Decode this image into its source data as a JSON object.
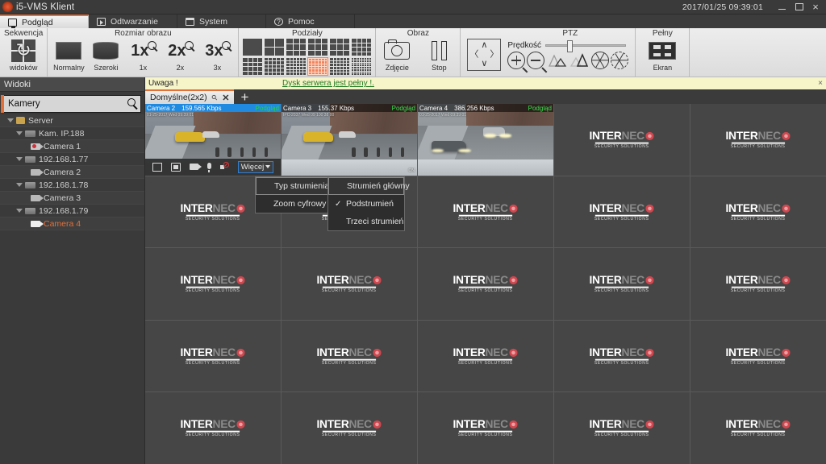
{
  "window": {
    "title": "i5-VMS Klient",
    "clock": "2017/01/25 09:39:01",
    "minimize": "–",
    "maximize": "□",
    "close": "×"
  },
  "menu_tabs": [
    {
      "label": "Podgląd",
      "icon": "monitor-icon",
      "active": true
    },
    {
      "label": "Odtwarzanie",
      "icon": "play-icon",
      "active": false
    },
    {
      "label": "System",
      "icon": "folder-icon",
      "active": false
    },
    {
      "label": "Pomoc",
      "icon": "help-icon",
      "active": false
    }
  ],
  "ribbon": {
    "groups": [
      {
        "title": "Sekwencja",
        "items": [
          {
            "label": "widoków",
            "icon": "sequence-views-icon"
          }
        ]
      },
      {
        "title": "Rozmiar obrazu",
        "items": [
          {
            "label": "Normalny",
            "icon": "screen-normal-icon"
          },
          {
            "label": "Szeroki",
            "icon": "screen-wide-icon"
          },
          {
            "label": "1x",
            "icon": "zoom-1x-icon"
          },
          {
            "label": "2x",
            "icon": "zoom-2x-icon"
          },
          {
            "label": "3x",
            "icon": "zoom-3x-icon"
          }
        ]
      },
      {
        "title": "Podziały",
        "items": []
      },
      {
        "title": "Obraz",
        "items": [
          {
            "label": "Zdjęcie",
            "icon": "camera-snapshot-icon"
          },
          {
            "label": "Stop",
            "icon": "pause-icon"
          }
        ]
      },
      {
        "title": "PTZ",
        "speed_label": "Prędkość",
        "items": []
      },
      {
        "title": "Pełny",
        "items": [
          {
            "label": "Ekran",
            "icon": "fullscreen-icon"
          }
        ]
      }
    ],
    "selected_layout_index": 9,
    "accent": "#e2703a"
  },
  "sidebar": {
    "header": "Widoki",
    "search_value": "Kamery",
    "search_placeholder": "Kamery",
    "tree": [
      {
        "label": "Server",
        "level": 0,
        "icon": "folder-icon",
        "expanded": true,
        "selected": false
      },
      {
        "label": "Kam. IP.188",
        "level": 1,
        "icon": "nvr-icon",
        "expanded": true,
        "selected": false
      },
      {
        "label": "Camera 1",
        "level": 2,
        "icon": "camera-recording-icon",
        "expanded": false,
        "selected": false
      },
      {
        "label": "192.168.1.77",
        "level": 1,
        "icon": "nvr-icon",
        "expanded": true,
        "selected": false
      },
      {
        "label": "Camera 2",
        "level": 2,
        "icon": "camera-icon",
        "expanded": false,
        "selected": false
      },
      {
        "label": "192.168.1.78",
        "level": 1,
        "icon": "nvr-icon",
        "expanded": true,
        "selected": false
      },
      {
        "label": "Camera 3",
        "level": 2,
        "icon": "camera-icon",
        "expanded": false,
        "selected": false
      },
      {
        "label": "192.168.1.79",
        "level": 1,
        "icon": "nvr-icon",
        "expanded": true,
        "selected": false
      },
      {
        "label": "Camera 4",
        "level": 2,
        "icon": "camera-icon",
        "expanded": false,
        "selected": true
      }
    ]
  },
  "notice": {
    "label": "Uwaga !",
    "message": "Dysk serwera jest pełny !.",
    "close": "×",
    "bg": "#f6f4c9",
    "link_color": "#207a20"
  },
  "tabstrip": {
    "tabs": [
      {
        "label": "Domyślne(2x2)",
        "pin": "⚲",
        "close": "✕"
      }
    ],
    "add": "+"
  },
  "grid": {
    "columns": 5,
    "rows": 5,
    "placeholder_logo": {
      "part1": "INTER",
      "part2": "NEC",
      "tagline": "SECURITY SOLUTIONS"
    },
    "tiles": [
      {
        "name": "Camera 2",
        "bitrate": "159.565 Kbps",
        "status": "Podgląd",
        "live": true,
        "active": true,
        "osd": "01-25-2017 Wed 09:39:01",
        "osd2": ""
      },
      {
        "name": "Camera 3",
        "bitrate": "155.37 Kbps",
        "status": "Podgląd",
        "live": true,
        "active": false,
        "osd": "IPC-2037 Wed 09 100 38 00",
        "osd2": "ON"
      },
      {
        "name": "Camera 4",
        "bitrate": "386.256 Kbps",
        "status": "Podgląd",
        "live": true,
        "active": false,
        "osd": "01-25-2017 Wed 09:39:01",
        "osd2": ""
      }
    ]
  },
  "video_toolbar": {
    "buttons": [
      {
        "name": "stop-button",
        "icon": "stop-icon"
      },
      {
        "name": "snapshot-button",
        "icon": "snapshot-icon"
      },
      {
        "name": "record-button",
        "icon": "record-camera-icon"
      },
      {
        "name": "microphone-button",
        "icon": "microphone-icon"
      },
      {
        "name": "mute-button",
        "icon": "speaker-muted-icon"
      }
    ],
    "more_label": "Więcej"
  },
  "context_menu": {
    "items": [
      {
        "label": "Typ strumienia",
        "submenu": true,
        "highlighted": true
      },
      {
        "label": "Zoom cyfrowy",
        "submenu": false,
        "highlighted": false
      }
    ],
    "submenu": {
      "items": [
        {
          "label": "Strumień główny",
          "checked": false,
          "highlighted": true
        },
        {
          "label": "Podstrumień",
          "checked": true,
          "highlighted": false
        },
        {
          "label": "Trzeci strumień",
          "checked": false,
          "highlighted": false
        }
      ],
      "check_glyph": "✓"
    }
  }
}
